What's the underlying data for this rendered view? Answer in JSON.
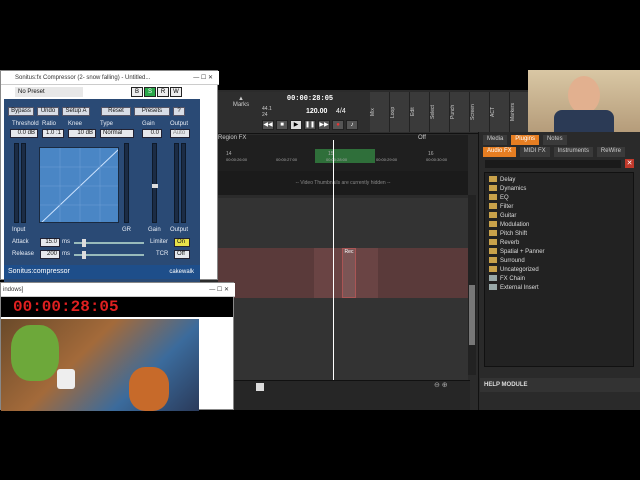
{
  "compressor": {
    "window_title": "Sonitus:fx Compressor (2- snow falling) - Untitled...",
    "preset": "No Preset",
    "buttons": [
      "Bypass",
      "Undo",
      "Setup A",
      "Reset",
      "Presets",
      "?"
    ],
    "labels": {
      "threshold": "Threshold",
      "ratio": "Ratio",
      "knee": "Knee",
      "type": "Type",
      "gain": "Gain",
      "output": "Output",
      "input": "Input",
      "gr": "GR",
      "attack": "Attack",
      "release": "Release",
      "limiter": "Limiter",
      "tcr": "TCR",
      "ms": "ms",
      "auto": "Auto"
    },
    "values": {
      "threshold": "0.0 dB",
      "ratio": "1.0 :1",
      "knee": "10 dB",
      "type": "Normal",
      "gain": "0.0",
      "attack": "15.0",
      "release": "200",
      "limiter": "On",
      "tcr": "Off"
    },
    "brand": "Sonitus:compressor",
    "vendor": "cakewalk"
  },
  "video_window": {
    "title": "indows]",
    "timecode": "00:00:28:05"
  },
  "transport": {
    "time": "00:00:28:05",
    "sample_rate": "44.1",
    "bit_depth": "24",
    "tempo": "120.00",
    "meter": "4/4",
    "marks_label": "Marks"
  },
  "panel_tabs": [
    "Mix",
    "Loop",
    "Edit",
    "Select",
    "Punch",
    "Screen",
    "ACT",
    "Markers"
  ],
  "timeline": {
    "region_fx": "Region FX",
    "off": "Off",
    "ruler": [
      "14",
      "15",
      "16"
    ],
    "times": [
      "00:00:26:00",
      "00:00:27:00",
      "00:00:28:00",
      "00:00:29:00",
      "00:00:30:00"
    ],
    "notice": "-- Video Thumbnails are currently hidden --",
    "clip_label": "Rec"
  },
  "browser": {
    "tabs": [
      "Media",
      "Plugins",
      "Notes"
    ],
    "subtabs": [
      "Audio FX",
      "MIDI FX",
      "Instruments",
      "ReWire"
    ],
    "items": [
      "Delay",
      "Dynamics",
      "EQ",
      "Filter",
      "Guitar",
      "Modulation",
      "Pitch Shift",
      "Reverb",
      "Spatial + Panner",
      "Surround",
      "Uncategorized",
      "FX Chain",
      "External Insert"
    ],
    "help": "HELP MODULE"
  }
}
